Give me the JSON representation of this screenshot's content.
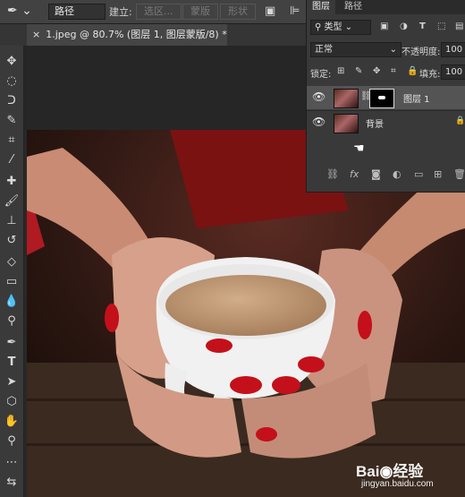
{
  "options_bar": {
    "tool_icon": "pen-icon",
    "mode_value": "路径",
    "make_label": "建立:",
    "selection_button": "选区...",
    "mask_button": "蒙版",
    "shape_button": "形状"
  },
  "document_tab": {
    "close_glyph": "×",
    "title": "1.jpeg @ 80.7% (图层 1, 图层蒙版/8) *"
  },
  "toolbar": {
    "tools": [
      "move-tool",
      "marquee-tool",
      "lasso-tool",
      "quick-select-tool",
      "crop-tool",
      "eyedropper-tool",
      "healing-tool",
      "brush-tool",
      "stamp-tool",
      "history-brush-tool",
      "eraser-tool",
      "gradient-tool",
      "blur-tool",
      "dodge-tool",
      "pen-tool",
      "type-tool",
      "path-select-tool",
      "shape-tool",
      "hand-tool",
      "zoom-tool",
      "more-tool"
    ]
  },
  "layers_panel": {
    "tabs": [
      "图层",
      "路径"
    ],
    "filter_value": "类型",
    "blend_mode": "正常",
    "opacity_label": "不透明度:",
    "opacity_value": "100",
    "lock_label": "锁定:",
    "fill_label": "填充:",
    "fill_value": "100",
    "layers": [
      {
        "name": "图层 1",
        "has_mask": true,
        "locked": false
      },
      {
        "name": "背景",
        "has_mask": false,
        "locked": true
      }
    ]
  },
  "watermark": {
    "brand": "Bai",
    "brand2": "经验",
    "url": "jingyan.baidu.com"
  }
}
